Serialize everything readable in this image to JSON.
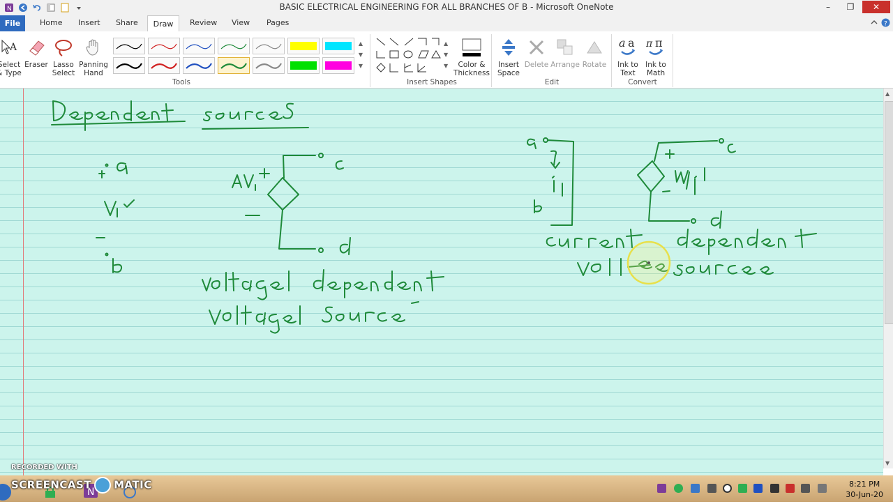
{
  "window": {
    "title": "BASIC ELECTRICAL ENGINEERING FOR ALL BRANCHES OF B  -  Microsoft OneNote"
  },
  "tabs": [
    "File",
    "Home",
    "Insert",
    "Share",
    "Draw",
    "Review",
    "View",
    "Pages"
  ],
  "ribbon": {
    "tools": {
      "select_type": [
        "Select",
        "& Type"
      ],
      "eraser": "Eraser",
      "lasso": [
        "Lasso",
        "Select"
      ],
      "panning": [
        "Panning",
        "Hand"
      ],
      "group_label": "Tools"
    },
    "insert_shapes": {
      "color_thickness": [
        "Color &",
        "Thickness"
      ],
      "group_label": "Insert Shapes"
    },
    "edit": {
      "insert_space": [
        "Insert",
        "Space"
      ],
      "delete": "Delete",
      "arrange": "Arrange",
      "rotate": "Rotate",
      "group_label": "Edit"
    },
    "convert": {
      "ink_to_text": [
        "Ink to",
        "Text"
      ],
      "ink_to_math": [
        "Ink to",
        "Math"
      ],
      "group_label": "Convert"
    }
  },
  "taskbar": {
    "time": "8:21 PM",
    "date": "30-Jun-20"
  },
  "watermark": {
    "recorded_with": "RECORDED WITH",
    "brand_left": "SCREENCAST",
    "brand_right": "MATIC"
  },
  "colors": {
    "page_bg": "#ccf4ec",
    "rule_line": "#9fd8d3",
    "margin_line": "#e27a7a",
    "ink": "#1f8a3a",
    "accent": "#2f6bbf"
  }
}
